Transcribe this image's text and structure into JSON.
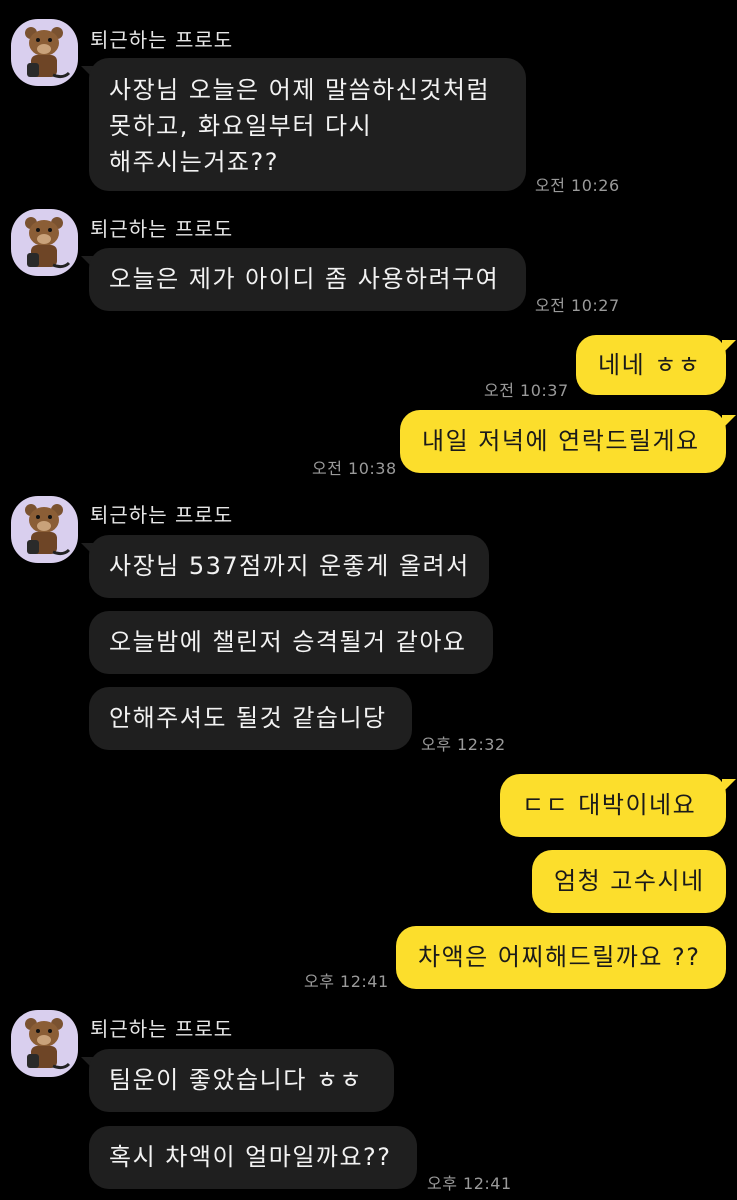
{
  "chat": {
    "sender_name": "퇴근하는 프로도",
    "messages": [
      {
        "text": "사장님 오늘은 어제 말씀하신것처럼\n못하고, 화요일부터 다시\n해주시는거죠??",
        "time": "오전 10:26"
      },
      {
        "text": "오늘은 제가 아이디 좀 사용하려구여",
        "time": "오전 10:27"
      },
      {
        "text": "네네 ㅎㅎ",
        "time": "오전 10:37"
      },
      {
        "text": "내일 저녁에 연락드릴게요",
        "time": "오전 10:38"
      },
      {
        "text": "사장님 537점까지 운좋게 올려서"
      },
      {
        "text": "오늘밤에 챌린저 승격될거 같아요"
      },
      {
        "text": "안해주셔도 될것 같습니당",
        "time": "오후 12:32"
      },
      {
        "text": "ㄷㄷ 대박이네요"
      },
      {
        "text": "엄청 고수시네"
      },
      {
        "text": "차액은 어찌해드릴까요 ??",
        "time": "오후 12:41"
      },
      {
        "text": "팀운이 좋았습니다 ㅎㅎ"
      },
      {
        "text": "혹시 차액이 얼마일까요??",
        "time": "오후 12:41"
      }
    ]
  }
}
